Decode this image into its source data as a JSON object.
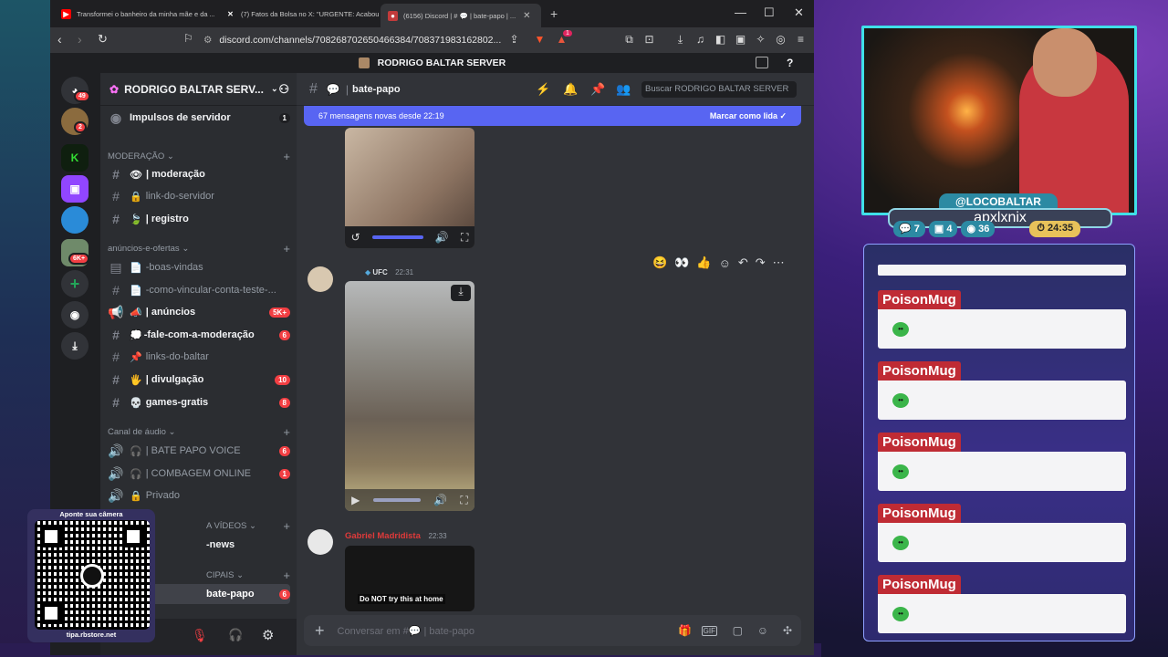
{
  "browser": {
    "tabs": [
      {
        "title": "Transformei o banheiro da minha mãe e da ...",
        "icon": "youtube-icon"
      },
      {
        "title": "(7) Fatos da Bolsa no X: \"URGENTE: Acabou ...",
        "icon": "x-icon"
      },
      {
        "title": "(6156) Discord | # 💬 | bate-papo | ...",
        "icon": "discord-icon"
      }
    ],
    "new_tab": "+",
    "url": "discord.com/channels/708268702650466384/708371983162802...",
    "brave_badge": "1"
  },
  "discord": {
    "top_title": "RODRIGO BALTAR SERVER",
    "guild_badges": {
      "home": "49",
      "g1": "2",
      "g5": "6K+"
    },
    "server_name": "RODRIGO BALTAR SERV...",
    "boost": {
      "label": "Impulsos de servidor",
      "count": "1"
    },
    "categories": {
      "moderacao": "MODERAÇÃO",
      "anuncios": "anúncios-e-ofertas",
      "audio": "Canal de áudio",
      "videos": "A VÍDEOS",
      "principais": "CIPAIS"
    },
    "channels": [
      {
        "name": "| moderação",
        "emoji": "👁",
        "unread": true,
        "count": ""
      },
      {
        "name": "link-do-servidor",
        "emoji": "🔒",
        "unread": false,
        "count": ""
      },
      {
        "name": "| registro",
        "emoji": "🍃",
        "unread": true,
        "count": ""
      },
      {
        "name": "-boas-vindas",
        "emoji": "📄",
        "unread": false,
        "count": ""
      },
      {
        "name": "-como-vincular-conta-teste-...",
        "emoji": "📄",
        "unread": false,
        "count": ""
      },
      {
        "name": "| anúncios",
        "emoji": "📣",
        "unread": true,
        "count": "5K+"
      },
      {
        "name": "-fale-com-a-moderação",
        "emoji": "💭",
        "unread": true,
        "count": "6"
      },
      {
        "name": "links-do-baltar",
        "emoji": "📌",
        "unread": false,
        "count": ""
      },
      {
        "name": "| divulgação",
        "emoji": "🖐",
        "unread": true,
        "count": "10"
      },
      {
        "name": "games-gratis",
        "emoji": "💀",
        "unread": true,
        "count": "8"
      }
    ],
    "voice": [
      {
        "name": "| BATE PAPO VOICE",
        "count": "6"
      },
      {
        "name": "| COMBAGEM ONLINE",
        "count": "1"
      },
      {
        "name": "Privado",
        "count": ""
      }
    ],
    "extra": [
      {
        "name": "-news",
        "count": ""
      },
      {
        "name": "bate-papo",
        "count": "6"
      }
    ],
    "channel_header": "bate-papo",
    "search_placeholder": "Buscar RODRIGO BALTAR SERVER",
    "banner_text": "67 mensagens novas desde 22:19",
    "banner_action": "Marcar como lida",
    "msg1": {
      "tag": "UFC",
      "time": "22:31"
    },
    "msg2": {
      "author": "Gabriel Madridista",
      "time": "22:33",
      "caption": "Do NOT try this at home"
    },
    "input_placeholder": "Conversar em #💬 | bate-papo",
    "reactions": [
      "😆",
      "👀",
      "👍"
    ]
  },
  "stream": {
    "handle": "@LOCOBALTAR",
    "username": "apxlxnix",
    "stats": {
      "a": "7",
      "b": "4",
      "c": "36",
      "time": "24:35"
    },
    "chat": [
      {
        "name": "PoisonMug"
      },
      {
        "name": "PoisonMug"
      },
      {
        "name": "PoisonMug"
      },
      {
        "name": "PoisonMug"
      },
      {
        "name": "PoisonMug"
      }
    ],
    "qr_title": "Aponte sua câmera",
    "qr_url": "tipa.rbstore.net"
  },
  "colors": {
    "discord_blurple": "#5865f2",
    "badge_red": "#f23f43",
    "chat_name_red": "#bf2b34",
    "cam_border": "#3fe0e8"
  }
}
